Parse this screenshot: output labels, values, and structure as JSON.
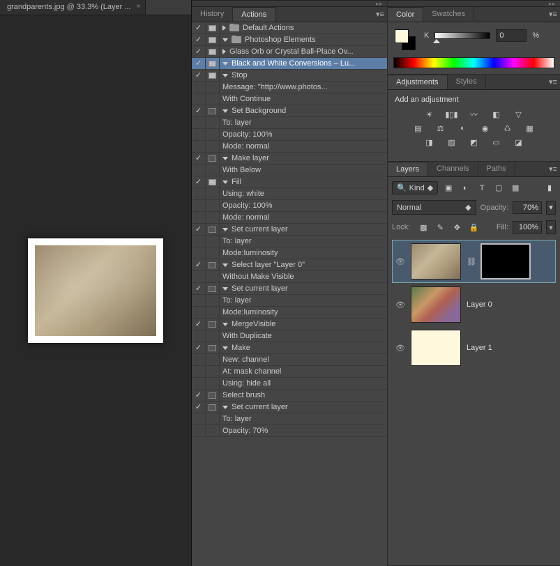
{
  "document": {
    "tab_title": "grandparents.jpg @ 33.3% (Layer ..."
  },
  "midPanel": {
    "tabs": {
      "history": "History",
      "actions": "Actions"
    },
    "actions": [
      {
        "check": true,
        "icon": "filled",
        "indent": 1,
        "tri": "right",
        "folder": true,
        "label": "Default Actions"
      },
      {
        "check": true,
        "icon": "filled",
        "indent": 1,
        "tri": "down",
        "folder": true,
        "label": "Photoshop Elements"
      },
      {
        "check": true,
        "icon": "filled",
        "indent": 3,
        "tri": "right",
        "label": "Glass Orb or Crystal Ball-Place Ov..."
      },
      {
        "check": true,
        "icon": "filled",
        "indent": 3,
        "tri": "down",
        "label": "Black and White Conversions – Lu...",
        "selected": true
      },
      {
        "check": true,
        "icon": "filled",
        "indent": 5,
        "tri": "down",
        "label": "Stop"
      },
      {
        "indent": 7,
        "label": "Message:   \"http://www.photos..."
      },
      {
        "indent": 7,
        "label": "With Continue"
      },
      {
        "check": true,
        "icon": "empty",
        "indent": 5,
        "tri": "down",
        "label": "Set Background"
      },
      {
        "indent": 7,
        "label": "To: layer"
      },
      {
        "indent": 7,
        "label": "Opacity: 100%"
      },
      {
        "indent": 7,
        "label": "Mode: normal"
      },
      {
        "check": true,
        "icon": "empty",
        "indent": 5,
        "tri": "down",
        "label": "Make layer"
      },
      {
        "indent": 7,
        "label": "With Below"
      },
      {
        "check": true,
        "icon": "filled",
        "indent": 5,
        "tri": "down",
        "label": "Fill"
      },
      {
        "indent": 7,
        "label": "Using: white"
      },
      {
        "indent": 7,
        "label": "Opacity: 100%"
      },
      {
        "indent": 7,
        "label": "Mode: normal"
      },
      {
        "check": true,
        "icon": "empty",
        "indent": 5,
        "tri": "down",
        "label": "Set current layer"
      },
      {
        "indent": 7,
        "label": "To: layer"
      },
      {
        "indent": 7,
        "label": "Mode:luminosity"
      },
      {
        "check": true,
        "icon": "empty",
        "indent": 5,
        "tri": "down",
        "label": "Select layer \"Layer 0\""
      },
      {
        "indent": 7,
        "label": "Without Make Visible"
      },
      {
        "check": true,
        "icon": "empty",
        "indent": 5,
        "tri": "down",
        "label": "Set current layer"
      },
      {
        "indent": 7,
        "label": "To: layer"
      },
      {
        "indent": 7,
        "label": "Mode:luminosity"
      },
      {
        "check": true,
        "icon": "empty",
        "indent": 5,
        "tri": "down",
        "label": "MergeVisible"
      },
      {
        "indent": 7,
        "label": "With Duplicate"
      },
      {
        "check": true,
        "icon": "empty",
        "indent": 5,
        "tri": "down",
        "label": "Make"
      },
      {
        "indent": 7,
        "label": "New: channel"
      },
      {
        "indent": 7,
        "label": "At: mask channel"
      },
      {
        "indent": 7,
        "label": "Using: hide all"
      },
      {
        "check": true,
        "icon": "empty",
        "indent": 5,
        "label": "Select brush"
      },
      {
        "check": true,
        "icon": "empty",
        "indent": 5,
        "tri": "down",
        "label": "Set current layer"
      },
      {
        "indent": 7,
        "label": "To: layer"
      },
      {
        "indent": 7,
        "label": "Opacity: 70%"
      }
    ]
  },
  "colorPanel": {
    "tabs": {
      "color": "Color",
      "swatches": "Swatches"
    },
    "mode": "K",
    "value": "0",
    "unit": "%"
  },
  "adjustments": {
    "tabs": {
      "adjustments": "Adjustments",
      "styles": "Styles"
    },
    "heading": "Add an adjustment"
  },
  "layersPanel": {
    "tabs": {
      "layers": "Layers",
      "channels": "Channels",
      "paths": "Paths"
    },
    "kind": "Kind",
    "blend": "Normal",
    "opacityLabel": "Opacity:",
    "opacityValue": "70%",
    "lockLabel": "Lock:",
    "fillLabel": "Fill:",
    "fillValue": "100%",
    "layers": [
      {
        "name": "",
        "selected": true,
        "thumbClass": "sepia",
        "mask": true
      },
      {
        "name": "Layer 0",
        "thumbClass": "color"
      },
      {
        "name": "Layer 1",
        "thumbClass": "cream"
      }
    ]
  }
}
